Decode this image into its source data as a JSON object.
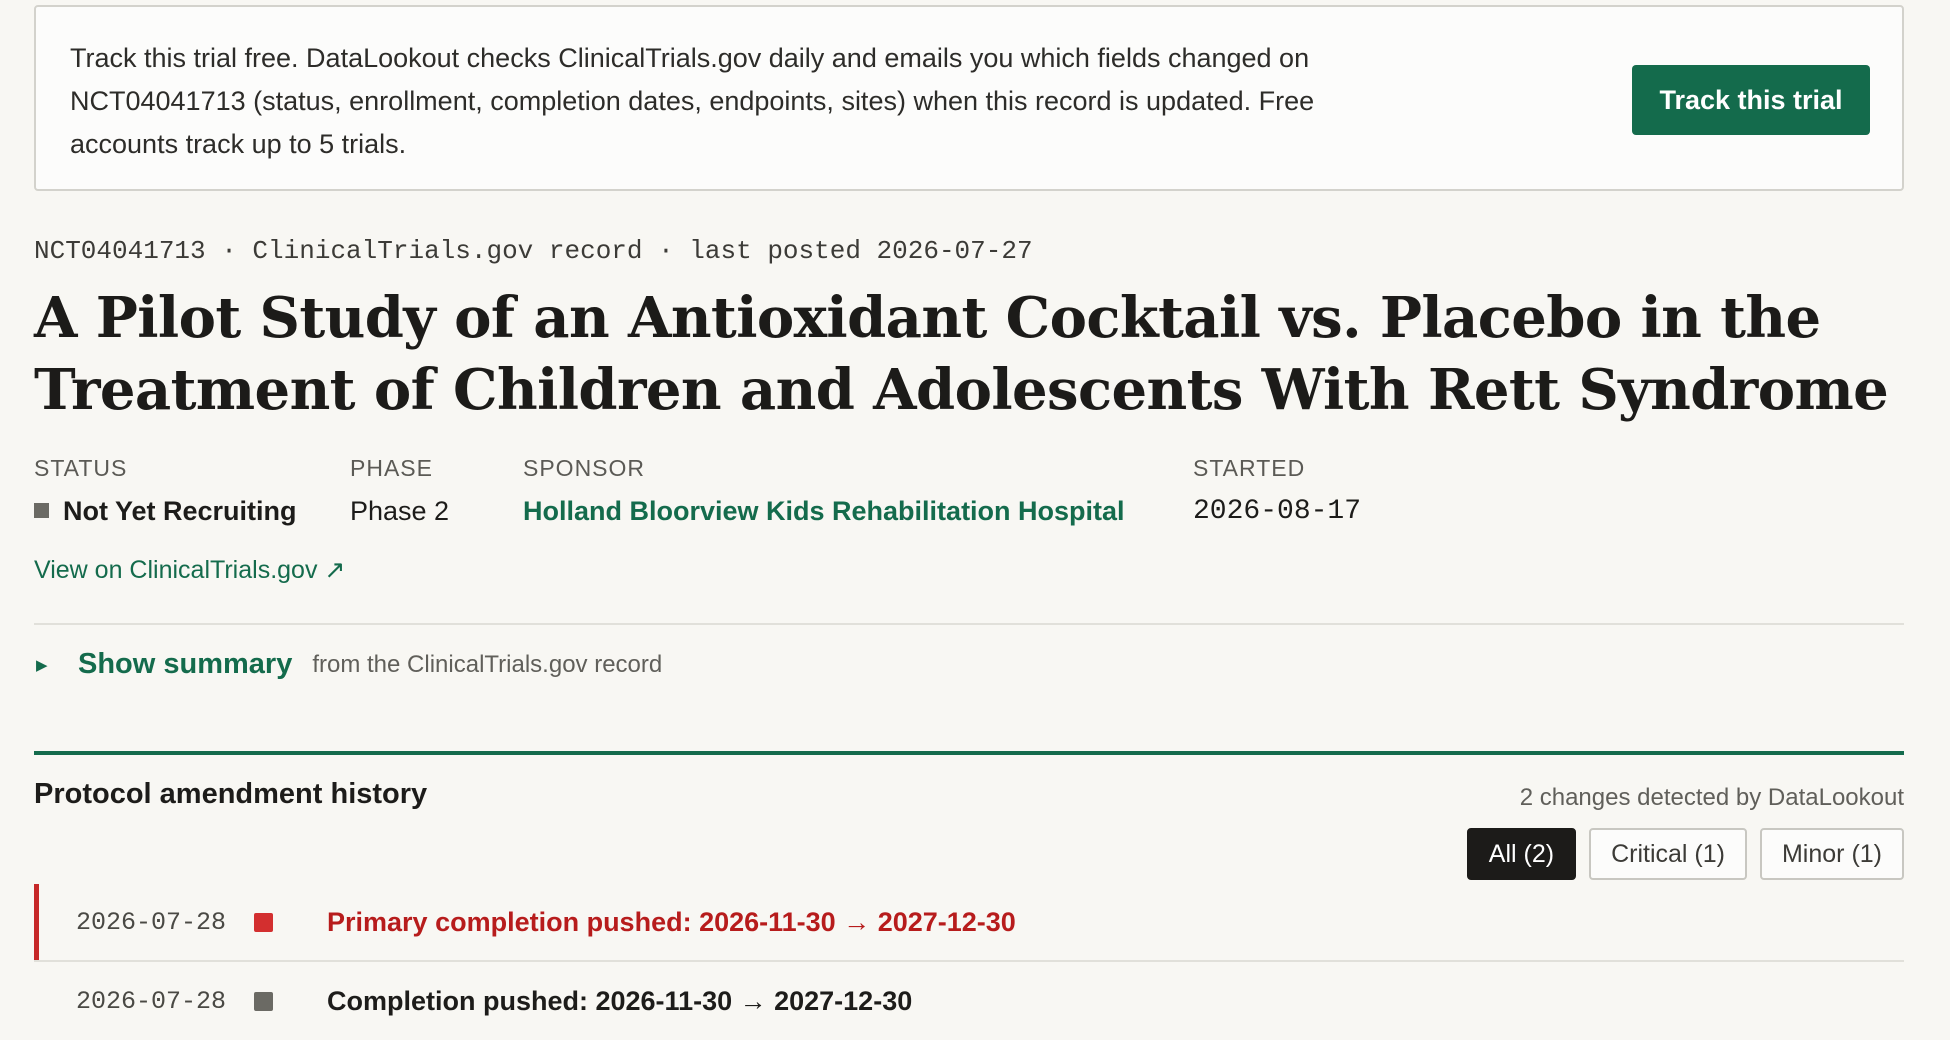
{
  "banner": {
    "text": "Track this trial free. DataLookout checks ClinicalTrials.gov daily and emails you which fields changed on NCT04041713 (status, enrollment, completion dates, endpoints, sites) when this record is updated. Free accounts track up to 5 trials.",
    "button_label": "Track this trial"
  },
  "record": {
    "meta": "NCT04041713 · ClinicalTrials.gov record · last posted 2026-07-27",
    "title": "A Pilot Study of an Antioxidant Cocktail vs. Placebo in the Treatment of Children and Adolescents With Rett Syndrome"
  },
  "facts": {
    "status_label": "STATUS",
    "status_value": "Not Yet Recruiting",
    "status_color": "#6b6a64",
    "phase_label": "PHASE",
    "phase_value": "Phase 2",
    "sponsor_label": "SPONSOR",
    "sponsor_value": "Holland Bloorview Kids Rehabilitation Hospital",
    "started_label": "STARTED",
    "started_value": "2026-08-17"
  },
  "external_link": "View on ClinicalTrials.gov ↗",
  "summary": {
    "toggle_label": "Show summary",
    "note": "from the ClinicalTrials.gov record"
  },
  "history": {
    "title": "Protocol amendment history",
    "count_text": "2 changes detected by DataLookout",
    "filters": [
      "All (2)",
      "Critical (1)",
      "Minor (1)"
    ],
    "active_filter": "All (2)",
    "entries": [
      {
        "date": "2026-07-28",
        "severity": "critical",
        "marker_color": "#d32f2f",
        "text": "Primary completion pushed: 2026-11-30 → 2027-12-30",
        "text_color": "#b71c1c"
      },
      {
        "date": "2026-07-28",
        "severity": "minor",
        "marker_color": "#6b6a64",
        "text": "Completion pushed: 2026-11-30 → 2027-12-30",
        "text_color": "#1d1c1a"
      }
    ]
  },
  "colors": {
    "accent": "#146b4c",
    "critical": "#c62828",
    "background": "#f8f7f3"
  }
}
